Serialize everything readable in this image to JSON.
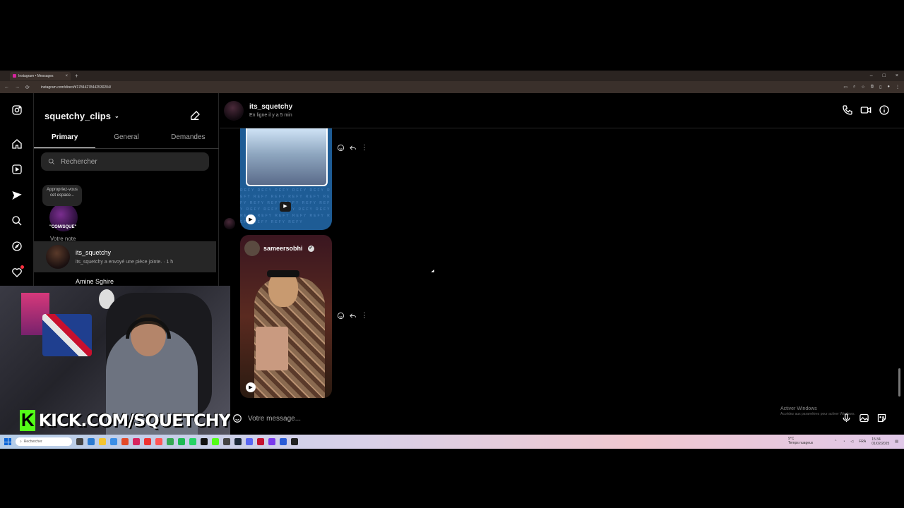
{
  "browser": {
    "tab_title": "Instagram • Messages",
    "tab_close": "×",
    "tab_new": "+",
    "url": "instagram.com/direct/t/17844278442530204/",
    "window_controls": [
      "–",
      "□",
      "×"
    ]
  },
  "rail": {
    "items": [
      "instagram-icon",
      "home-icon",
      "reels-icon",
      "messages-icon",
      "search-icon",
      "explore-icon",
      "notifications-icon"
    ]
  },
  "inbox": {
    "account_name": "squetchy_clips",
    "tabs": [
      "Primary",
      "General",
      "Demandes"
    ],
    "active_tab": "Primary",
    "search_placeholder": "Rechercher",
    "note": {
      "bubble_text": "Appropriez-vous cet espace...",
      "avatar_tag": "\"COM/SQUE\"",
      "label": "Votre note"
    },
    "conversations": [
      {
        "name": "its_squetchy",
        "preview": "its_squetchy a envoyé une pièce jointe. · 1 h"
      },
      {
        "name": "Amine Sghire",
        "preview": ""
      }
    ]
  },
  "webcam": {
    "brand_k": "K",
    "overlay_text": "KICK.COM/SQUETCHY"
  },
  "chat": {
    "contact_name": "its_squetchy",
    "contact_status": "En ligne il y a 5 min",
    "reel2_author": "sameersobhi",
    "verified_mark": "✔",
    "reel1_pattern": "REFY REFY REFY REFY REFY REFY REFY REFY REFY REFY REFY REFY REFY REFY REFY REFY REFY REFY REFY REFY REFY REFY REFY REFY REFY REFY REFY REFY REFY REFY",
    "play_glyph": "▶",
    "more_glyph": "⋮",
    "composer_placeholder": "Votre message..."
  },
  "watermark": {
    "title": "Activer Windows",
    "subtitle": "Accédez aux paramètres pour activer Windows."
  },
  "taskbar": {
    "search_label": "Rechercher",
    "weather": "9°C",
    "weather_sub": "Temps nuageux",
    "lang": "FRA",
    "time": "15:34",
    "date": "01/02/2025"
  },
  "colors": {
    "background": "#000000",
    "selected_row": "#262626",
    "kick_green": "#53fc18",
    "notification_red": "#ff3040"
  }
}
